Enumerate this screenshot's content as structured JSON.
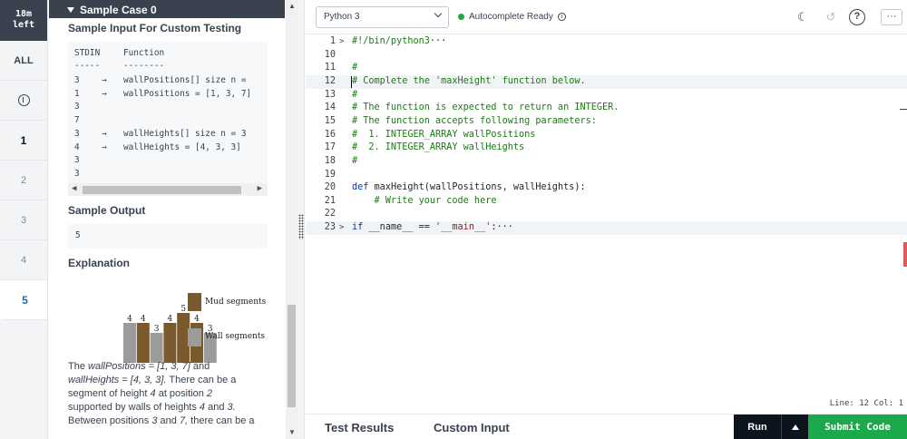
{
  "rail": {
    "timer_line1": "18m",
    "timer_line2": "left",
    "all_label": "ALL",
    "questions": [
      "1",
      "2",
      "3",
      "4",
      "5"
    ],
    "active_question": "5"
  },
  "problem": {
    "case_header": "Sample Case 0",
    "sample_input_title": "Sample Input For Custom Testing",
    "stdin_col1_header": "STDIN",
    "stdin_col2_header": "Function",
    "stdin_col1_rule": "-----",
    "stdin_col2_rule": "--------",
    "stdin_rows": [
      {
        "v": "3",
        "arr": "→",
        "fn": "wallPositions[] size n ="
      },
      {
        "v": "1",
        "arr": "→",
        "fn": "wallPositions = [1, 3, 7]"
      },
      {
        "v": "3",
        "arr": "",
        "fn": ""
      },
      {
        "v": "7",
        "arr": "",
        "fn": ""
      },
      {
        "v": "3",
        "arr": "→",
        "fn": "wallHeights[] size n = 3"
      },
      {
        "v": "4",
        "arr": "→",
        "fn": "wallHeights = [4, 3, 3]"
      },
      {
        "v": "3",
        "arr": "",
        "fn": ""
      },
      {
        "v": "3",
        "arr": "",
        "fn": ""
      }
    ],
    "sample_output_title": "Sample Output",
    "sample_output_value": "5",
    "explanation_title": "Explanation",
    "figure": {
      "bar_labels": [
        "4",
        "4",
        "3",
        "4",
        "5",
        "4",
        "3"
      ],
      "bar_kinds": [
        "wall",
        "mud",
        "wall",
        "mud",
        "mud",
        "mud",
        "wall"
      ],
      "bar_values": [
        4,
        4,
        3,
        4,
        5,
        4,
        3
      ],
      "mud_color": "#7a5a2c",
      "wall_color": "#9b9b9b",
      "legend_mud": "Mud segments",
      "legend_wall": "Wall segments"
    },
    "explanation": {
      "p1": "The ",
      "p2": "wallPositions = [1, 3, 7]",
      "p3": " and ",
      "p4": "wallHeights = [4, 3, 3].",
      "p5": "  There can be a segment of height ",
      "p6": "4",
      "p7": " at position ",
      "p8": "2",
      "p9": " supported by walls of heights ",
      "p10": "4",
      "p11": " and ",
      "p12": "3.",
      "p13": "  Between positions ",
      "p14": "3",
      "p15": " and ",
      "p16": "7,",
      "p17": " there can be a"
    }
  },
  "editor": {
    "language": "Python 3",
    "autocomplete_status": "Autocomplete Ready",
    "status_line": "Line: 12 Col: 1",
    "lines": [
      {
        "n": "1",
        "fold": ">",
        "parts": [
          {
            "t": "#!/bin/python3",
            "c": "cm"
          },
          {
            "t": "···",
            "c": "plain"
          }
        ]
      },
      {
        "n": "10",
        "fold": "",
        "parts": []
      },
      {
        "n": "11",
        "fold": "",
        "parts": [
          {
            "t": "#",
            "c": "cm"
          }
        ]
      },
      {
        "n": "12",
        "fold": "",
        "parts": [
          {
            "t": "# Complete the 'maxHeight' function below.",
            "c": "cm"
          }
        ],
        "hl": true
      },
      {
        "n": "13",
        "fold": "",
        "parts": [
          {
            "t": "#",
            "c": "cm"
          }
        ]
      },
      {
        "n": "14",
        "fold": "",
        "parts": [
          {
            "t": "# The function is expected to return an INTEGER.",
            "c": "cm"
          }
        ]
      },
      {
        "n": "15",
        "fold": "",
        "parts": [
          {
            "t": "# The function accepts following parameters:",
            "c": "cm"
          }
        ]
      },
      {
        "n": "16",
        "fold": "",
        "parts": [
          {
            "t": "#  1. INTEGER_ARRAY wallPositions",
            "c": "cm"
          }
        ]
      },
      {
        "n": "17",
        "fold": "",
        "parts": [
          {
            "t": "#  2. INTEGER_ARRAY wallHeights",
            "c": "cm"
          }
        ]
      },
      {
        "n": "18",
        "fold": "",
        "parts": [
          {
            "t": "#",
            "c": "cm"
          }
        ]
      },
      {
        "n": "19",
        "fold": "",
        "parts": []
      },
      {
        "n": "20",
        "fold": "",
        "parts": [
          {
            "t": "def",
            "c": "kw"
          },
          {
            "t": " maxHeight(wallPositions, wallHeights):",
            "c": "plain"
          }
        ]
      },
      {
        "n": "21",
        "fold": "",
        "parts": [
          {
            "t": "    # Write your code here",
            "c": "cm"
          }
        ]
      },
      {
        "n": "22",
        "fold": "",
        "parts": []
      },
      {
        "n": "23",
        "fold": ">",
        "parts": [
          {
            "t": "if",
            "c": "kw"
          },
          {
            "t": " __name__ == ",
            "c": "plain"
          },
          {
            "t": "'__main__'",
            "c": "str"
          },
          {
            "t": ":···",
            "c": "plain"
          }
        ],
        "hl": true
      }
    ]
  },
  "bottom": {
    "test_results": "Test Results",
    "custom_input": "Custom Input",
    "run": "Run",
    "submit": "Submit Code"
  }
}
